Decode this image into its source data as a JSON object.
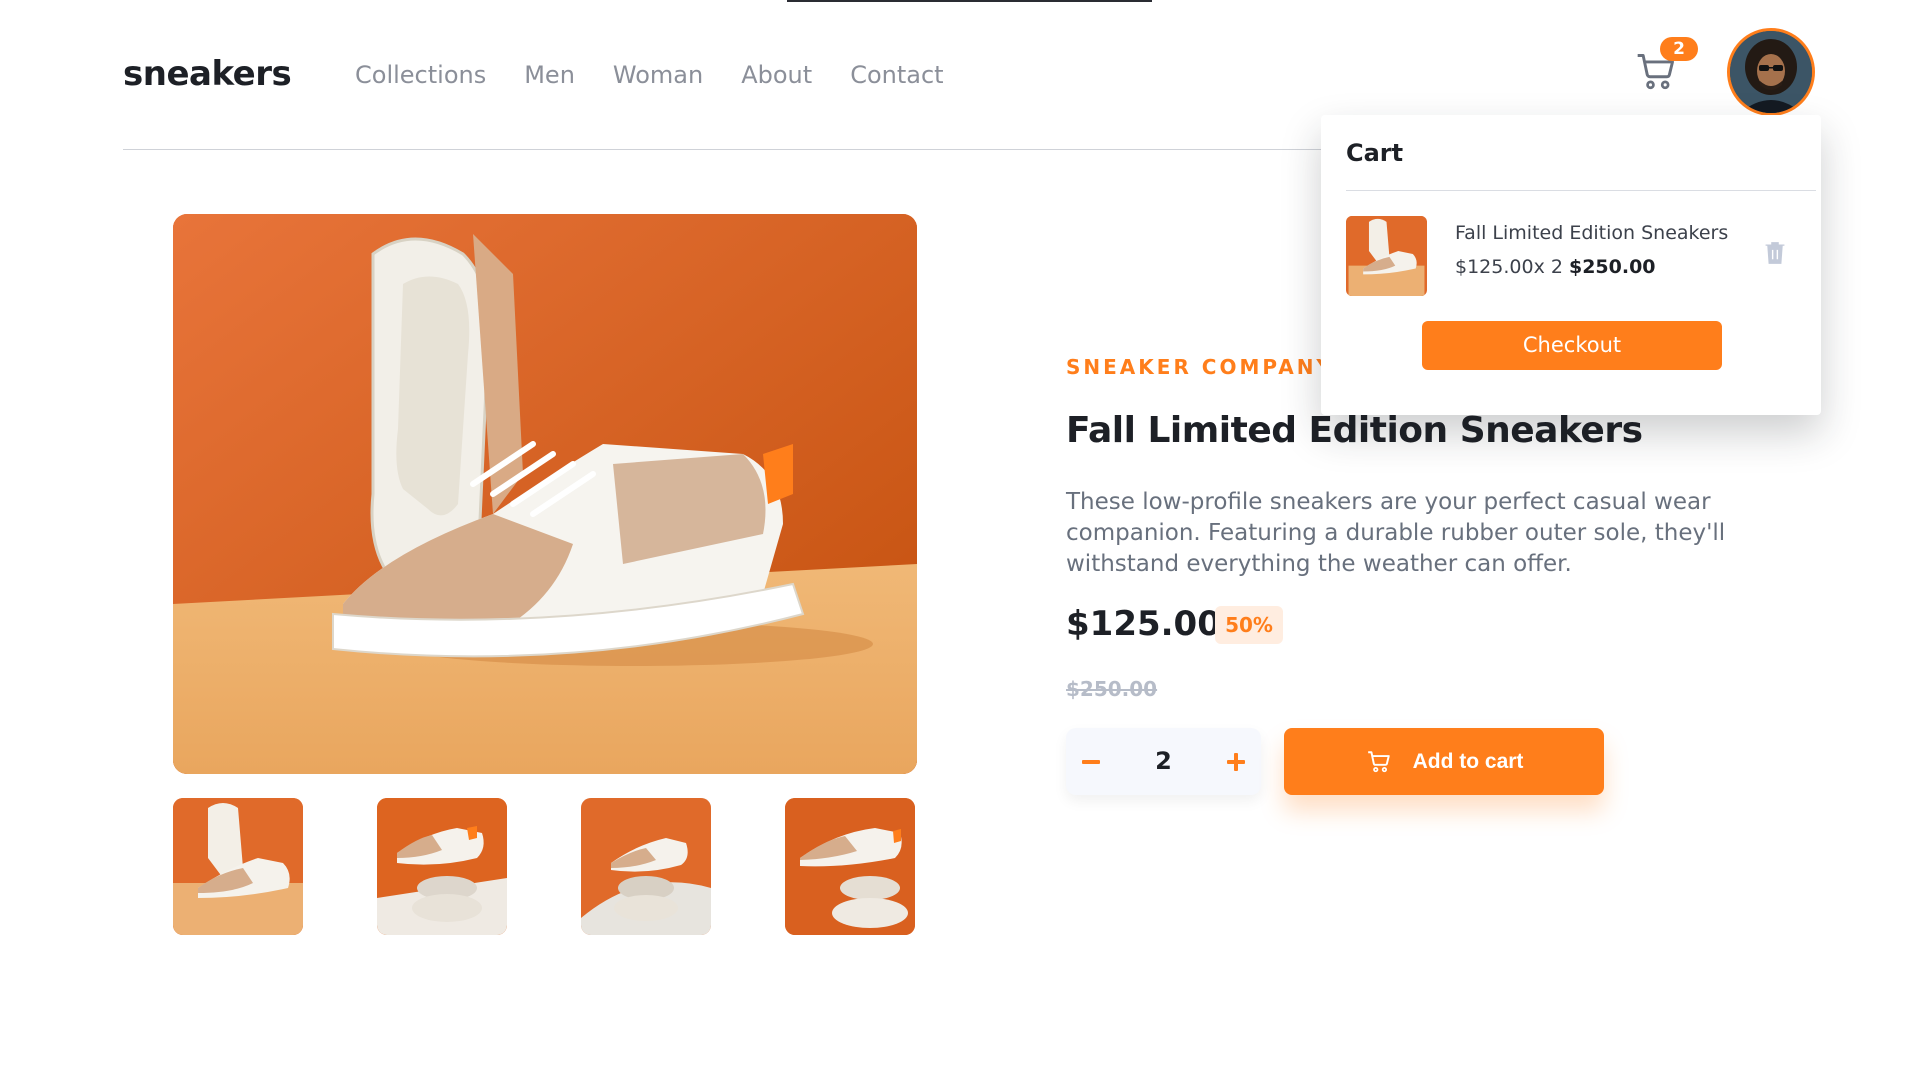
{
  "header": {
    "logo": "sneakers",
    "nav": [
      "Collections",
      "Men",
      "Woman",
      "About",
      "Contact"
    ],
    "cart_count": "2"
  },
  "gallery": {
    "thumbnail_count": 4
  },
  "product": {
    "company": "SNEAKER COMPANY",
    "title": "Fall Limited Edition Sneakers",
    "description": "These low-profile sneakers are your perfect casual wear companion. Featuring a durable rubber outer sole, they'll withstand everything the weather can offer.",
    "price": "$125.00",
    "discount": "50%",
    "old_price": "$250.00",
    "quantity": "2",
    "add_to_cart_label": "Add to cart"
  },
  "cart_popup": {
    "heading": "Cart",
    "item_name": "Fall Limited Edition Sneakers",
    "item_unit": "$125.00x 2 ",
    "item_total": "$250.00",
    "checkout_label": "Checkout"
  },
  "colors": {
    "accent": "#ff7e1b",
    "accent_pale": "#ffede0",
    "text_dark": "#1d2026",
    "text_grey": "#68707d"
  }
}
